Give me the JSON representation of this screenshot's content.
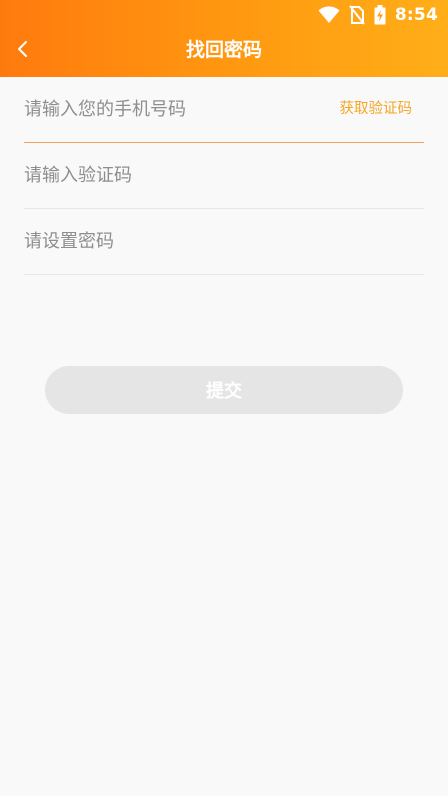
{
  "status_bar": {
    "time": "8:54",
    "icons": [
      "wifi-icon",
      "no-sim-icon",
      "battery-charging-icon"
    ]
  },
  "header": {
    "title": "找回密码",
    "back_icon": "chevron-left-icon"
  },
  "form": {
    "phone": {
      "placeholder": "请输入您的手机号码",
      "value": ""
    },
    "get_code_label": "获取验证码",
    "code": {
      "placeholder": "请输入验证码",
      "value": ""
    },
    "password": {
      "placeholder": "请设置密码",
      "value": ""
    }
  },
  "submit_label": "提交",
  "colors": {
    "header_gradient_start": "#ff7a0e",
    "header_gradient_end": "#ffae18",
    "accent": "#f5a623",
    "active_underline": "#f0a45a",
    "submit_disabled_bg": "#e5e5e5",
    "background": "#f9f9f9"
  }
}
